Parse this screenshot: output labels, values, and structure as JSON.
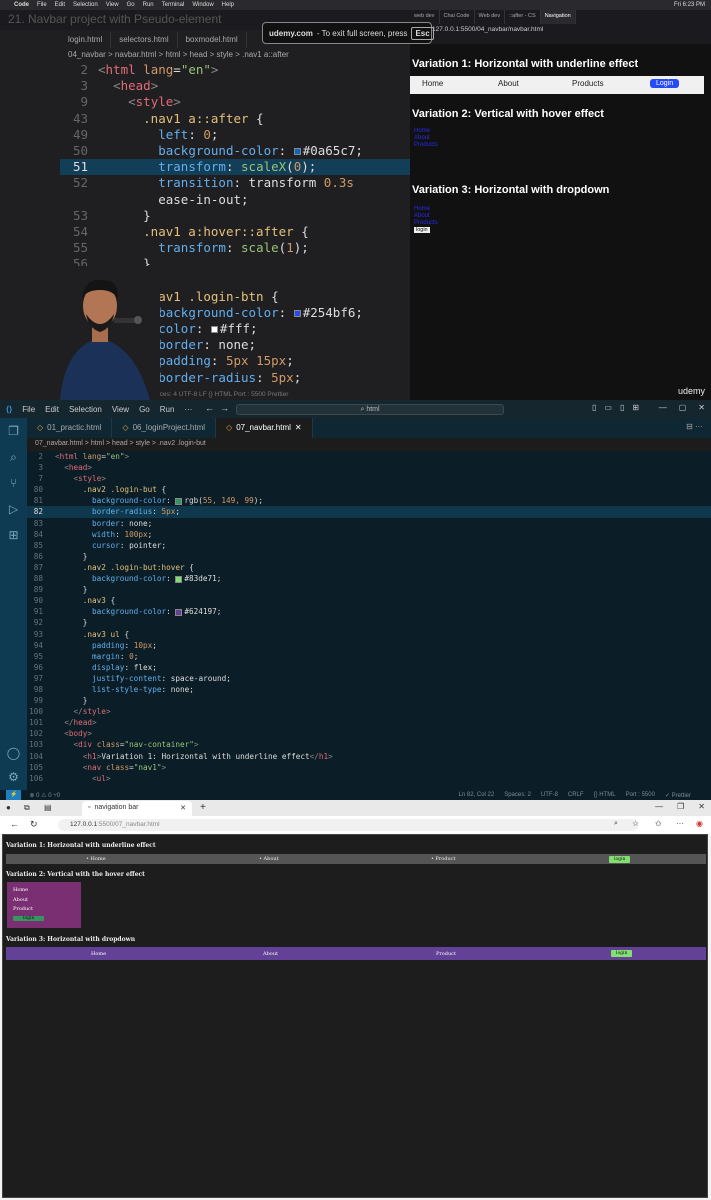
{
  "top": {
    "menubar": {
      "apple": "",
      "items": [
        "Code",
        "File",
        "Edit",
        "Selection",
        "View",
        "Go",
        "Run",
        "Terminal",
        "Window",
        "Help"
      ],
      "clock": "Fri 6:23 PM"
    },
    "video_title": "21. Navbar project with Pseudo-element",
    "fullscreen": {
      "domain": "udemy.com",
      "message": "- To exit full screen, press",
      "key": "Esc"
    },
    "chrome_tabs": [
      "web dev",
      "Chai Code",
      "Web dev",
      "::after - CS",
      "Navigation"
    ],
    "chrome_url": "127.0.0.1:5500/04_navbar/navbar.html",
    "editor_tabs": [
      "login.html",
      "selectors.html",
      "boxmodel.html"
    ],
    "editor_breadcrumb": "04_navbar > navbar.html > html > head > style > .nav1 a::after",
    "code_lines": [
      {
        "n": "2",
        "html": "<span class='g'>&lt;</span><span class='t'>html</span> <span class='a'>lang</span><span class='w'>=</span><span class='s'>\"en\"</span><span class='g'>&gt;</span>"
      },
      {
        "n": "3",
        "html": "  <span class='g'>&lt;</span><span class='t'>head</span><span class='g'>&gt;</span>"
      },
      {
        "n": "9",
        "html": "    <span class='g'>&lt;</span><span class='t'>style</span><span class='g'>&gt;</span>"
      },
      {
        "n": "43",
        "html": "      <span class='sel'>.nav1 a::after</span> <span class='w'>{</span>"
      },
      {
        "n": "49",
        "html": "        <span class='p'>left</span><span class='w'>: </span><span class='n'>0</span><span class='w'>;</span>"
      },
      {
        "n": "50",
        "html": "        <span class='p'>background-color</span><span class='w'>: </span><span class='sw' style='background:#0a65c7'></span><span class='w'>#0a65c7;</span>"
      },
      {
        "n": "51",
        "html": "        <span class='p'>transform</span><span class='w'>: </span><span class='s'>scaleX</span><span class='w'>(</span><span class='n'>0</span><span class='w'>);</span>",
        "hl": true
      },
      {
        "n": "52",
        "html": "        <span class='p'>transition</span><span class='w'>: transform </span><span class='n'>0.3s</span>"
      },
      {
        "n": "",
        "html": "        <span class='w'>ease-in-out;</span>"
      },
      {
        "n": "53",
        "html": "      <span class='w'>}</span>"
      },
      {
        "n": "54",
        "html": "      <span class='sel'>.nav1 a:hover::after</span> <span class='w'>{</span>"
      },
      {
        "n": "55",
        "html": "        <span class='p'>transform</span><span class='w'>: </span><span class='s'>scale</span><span class='w'>(</span><span class='n'>1</span><span class='w'>);</span>"
      },
      {
        "n": "56",
        "html": "      <span class='w'>}</span>"
      },
      {
        "n": "",
        "html": ""
      },
      {
        "n": "",
        "html": "      <span class='sel'>.nav1 .login-btn</span> <span class='w'>{</span>"
      },
      {
        "n": "",
        "html": "        <span class='p'>background-color</span><span class='w'>: </span><span class='sw' style='background:#254bf6'></span><span class='w'>#254bf6;</span>"
      },
      {
        "n": "",
        "html": "        <span class='p'>color</span><span class='w'>: </span><span class='sw' style='background:#fff'></span><span class='w'>#fff;</span>"
      },
      {
        "n": "",
        "html": "        <span class='p'>border</span><span class='w'>: none;</span>"
      },
      {
        "n": "",
        "html": "        <span class='p'>padding</span><span class='w'>: </span><span class='n'>5px 15px</span><span class='w'>;</span>"
      },
      {
        "n": "",
        "html": "        <span class='p'>border-radius</span><span class='w'>: </span><span class='n'>5px</span><span class='w'>;</span>"
      }
    ],
    "status": "Ln 26   Spaces: 4   UTF-8   LF   {} HTML   Port : 5500   Prettier",
    "preview": {
      "h1": "Variation 1: Horizontal with underline effect",
      "nav": [
        "Home",
        "About",
        "Products"
      ],
      "login": "Login",
      "h2": "Variation 2: Vertical with hover effect",
      "v2_links": [
        "Home",
        "About",
        "Products"
      ],
      "h3": "Variation 3: Horizontal with dropdown",
      "v3_links": [
        "Home",
        "About",
        "Products"
      ],
      "v3_login": "login"
    },
    "udemy": "udemy"
  },
  "vscode": {
    "menu": [
      "File",
      "Edit",
      "Selection",
      "View",
      "Go",
      "Run",
      "···"
    ],
    "search": "html",
    "tabs": [
      {
        "label": "01_practic.html",
        "active": false
      },
      {
        "label": "06_loginProject.html",
        "active": false
      },
      {
        "label": "07_navbar.html",
        "active": true
      }
    ],
    "breadcrumb": "07_navbar.html > html > head > style > .nav2 .login-but",
    "lines": [
      {
        "n": "2",
        "html": "<span class='g'>&lt;</span><span class='t'>html</span> <span class='a'>lang</span><span class='w'>=</span><span class='s'>\"en\"</span><span class='g'>&gt;</span>"
      },
      {
        "n": "3",
        "html": "  <span class='g'>&lt;</span><span class='t'>head</span><span class='g'>&gt;</span>"
      },
      {
        "n": "7",
        "html": "    <span class='g'>&lt;</span><span class='t'>style</span><span class='g'>&gt;</span>"
      },
      {
        "n": "80",
        "html": "      <span class='sel'>.nav2 .login-but</span> <span class='w'>{</span>"
      },
      {
        "n": "81",
        "html": "        <span class='p'>background-color</span><span class='w'>: </span><span class='sw' style='background:rgb(55,149,99)'></span><span class='w'>rgb(</span><span class='n'>55, 149, 99</span><span class='w'>);</span>"
      },
      {
        "n": "82",
        "html": "        <span class='p'>border-radius</span><span class='w'>: </span><span class='n'>5px</span><span class='w'>;</span>",
        "hl": true
      },
      {
        "n": "83",
        "html": "        <span class='p'>border</span><span class='w'>: none;</span>"
      },
      {
        "n": "84",
        "html": "        <span class='p'>width</span><span class='w'>: </span><span class='n'>100px</span><span class='w'>;</span>"
      },
      {
        "n": "85",
        "html": "        <span class='p'>cursor</span><span class='w'>: pointer;</span>"
      },
      {
        "n": "86",
        "html": "      <span class='w'>}</span>"
      },
      {
        "n": "87",
        "html": "      <span class='sel'>.nav2 .login-but:hover</span> <span class='w'>{</span>"
      },
      {
        "n": "88",
        "html": "        <span class='p'>background-color</span><span class='w'>: </span><span class='sw' style='background:#83de71'></span><span class='w'>#83de71;</span>"
      },
      {
        "n": "89",
        "html": "      <span class='w'>}</span>"
      },
      {
        "n": "90",
        "html": "      <span class='sel'>.nav3</span> <span class='w'>{</span>"
      },
      {
        "n": "91",
        "html": "        <span class='p'>background-color</span><span class='w'>: </span><span class='sw' style='background:#624197'></span><span class='w'>#624197;</span>"
      },
      {
        "n": "92",
        "html": "      <span class='w'>}</span>"
      },
      {
        "n": "93",
        "html": "      <span class='sel'>.nav3 ul</span> <span class='w'>{</span>"
      },
      {
        "n": "94",
        "html": "        <span class='p'>padding</span><span class='w'>: </span><span class='n'>10px</span><span class='w'>;</span>"
      },
      {
        "n": "95",
        "html": "        <span class='p'>margin</span><span class='w'>: </span><span class='n'>0</span><span class='w'>;</span>"
      },
      {
        "n": "96",
        "html": "        <span class='p'>display</span><span class='w'>: flex;</span>"
      },
      {
        "n": "97",
        "html": "        <span class='p'>justify-content</span><span class='w'>: space-around;</span>"
      },
      {
        "n": "98",
        "html": "        <span class='p'>list-style-type</span><span class='w'>: none;</span>"
      },
      {
        "n": "99",
        "html": "      <span class='w'>}</span>"
      },
      {
        "n": "100",
        "html": "    <span class='g'>&lt;/</span><span class='t'>style</span><span class='g'>&gt;</span>"
      },
      {
        "n": "101",
        "html": "  <span class='g'>&lt;/</span><span class='t'>head</span><span class='g'>&gt;</span>"
      },
      {
        "n": "102",
        "html": "  <span class='g'>&lt;</span><span class='t'>body</span><span class='g'>&gt;</span>"
      },
      {
        "n": "103",
        "html": "    <span class='g'>&lt;</span><span class='t'>div</span> <span class='a'>class</span><span class='w'>=</span><span class='s'>\"nav-container\"</span><span class='g'>&gt;</span>"
      },
      {
        "n": "104",
        "html": "      <span class='g'>&lt;</span><span class='t'>h1</span><span class='g'>&gt;</span><span class='w'>Variation 1: Horizontal with underline effect</span><span class='g'>&lt;/</span><span class='t'>h1</span><span class='g'>&gt;</span>"
      },
      {
        "n": "105",
        "html": "      <span class='g'>&lt;</span><span class='t'>nav</span> <span class='a'>class</span><span class='w'>=</span><span class='s'>\"nav1\"</span><span class='g'>&gt;</span>"
      },
      {
        "n": "106",
        "html": "        <span class='g'>&lt;</span><span class='t'>ul</span><span class='g'>&gt;</span>"
      }
    ],
    "status": {
      "left": "⊗ 0 ⚠ 0   ⑂0",
      "pos": "Ln 82, Col 22",
      "spaces": "Spaces: 2",
      "enc": "UTF-8",
      "eol": "CRLF",
      "lang": "{} HTML",
      "port": "Port : 5500",
      "prettier": "✓ Prettier"
    }
  },
  "browser": {
    "tab_title": "navigation bar",
    "url_host": "127.0.0.1",
    "url_rest": ":5500/07_navbar.html",
    "page": {
      "h1": "Variation 1: Horizontal with underline effect",
      "nav1": [
        "Home",
        "About",
        "Product"
      ],
      "nav1_login": "login",
      "h2": "Variation 2: Vertical with the hover effect",
      "nav2": [
        "Home",
        "About",
        "Product"
      ],
      "nav2_login": "login",
      "h3": "Variation 3: Horizontal with dropdown",
      "nav3": [
        "Home",
        "About",
        "Product"
      ],
      "nav3_login": "login"
    }
  }
}
